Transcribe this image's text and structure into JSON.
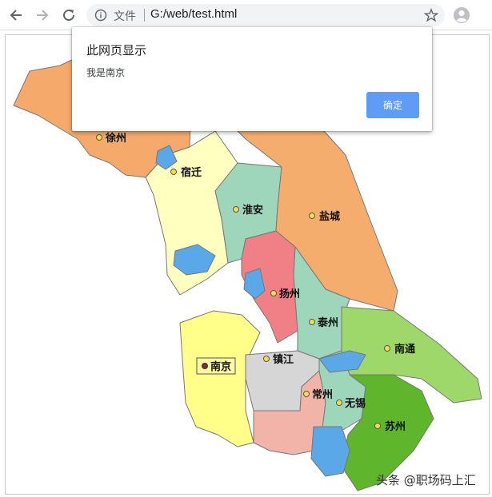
{
  "browser": {
    "address": {
      "file_label": "文件",
      "url": "G:/web/test.html"
    }
  },
  "dialog": {
    "title": "此网页显示",
    "message": "我是南京",
    "ok_label": "确定"
  },
  "map": {
    "cities": [
      {
        "name": "徐州"
      },
      {
        "name": "宿迁"
      },
      {
        "name": "淮安"
      },
      {
        "name": "盐城"
      },
      {
        "name": "扬州"
      },
      {
        "name": "泰州"
      },
      {
        "name": "南通"
      },
      {
        "name": "南京"
      },
      {
        "name": "镇江"
      },
      {
        "name": "常州"
      },
      {
        "name": "无锡"
      },
      {
        "name": "苏州"
      }
    ],
    "watermark": "头条 @职场码上汇"
  },
  "colors": {
    "accent": "#5e9cf5",
    "xuzhou": "#f5a96b",
    "suqian": "#ffffc0",
    "huaian": "#9ed6bc",
    "yancheng": "#f5ad6e",
    "yangzhou": "#f07f86",
    "taizhou": "#9ed6bc",
    "nantong": "#9fd86a",
    "nanjing": "#ffff8a",
    "zhenjiang": "#d6d6d6",
    "changzhou": "#f2b4a8",
    "wuxi": "#9ed6bc",
    "suzhou": "#5fb52b",
    "water": "#5aa8e8"
  }
}
